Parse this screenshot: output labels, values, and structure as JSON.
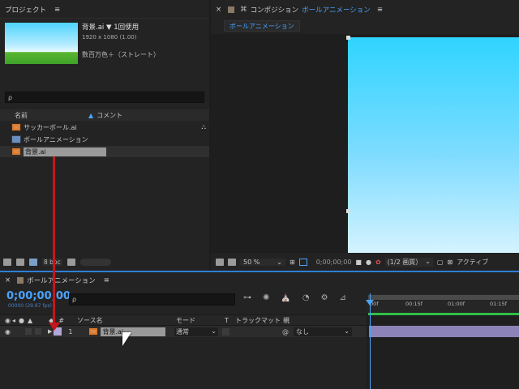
{
  "project": {
    "title": "プロジェクト",
    "menu_glyph": "≡",
    "selected_name": "背景.ai ▼",
    "used_count": "1回使用",
    "resolution": "1920 x 1080 (1.00)",
    "color_mode": "数百万色＋（ストレート）",
    "search_placeholder": "ρ",
    "col_name": "名前",
    "col_comment": "コメント",
    "items": [
      {
        "name": "サッカーボール.ai",
        "type": "ai"
      },
      {
        "name": "ボールアニメーション",
        "type": "comp"
      },
      {
        "name": "背景.ai",
        "type": "ai"
      }
    ],
    "bpc": "8 bpc"
  },
  "comp_viewer": {
    "close_glyph": "×",
    "title_prefix": "コンポジション",
    "comp_name": "ボールアニメーション",
    "menu_glyph": "≡",
    "tab": "ボールアニメーション",
    "zoom": "50 %",
    "timecode": "0;00;00;00",
    "resolution": "(1/2 画質）",
    "active_camera": "アクティブ"
  },
  "timeline": {
    "close_glyph": "×",
    "title": "ボールアニメーション",
    "menu_glyph": "≡",
    "timecode": "0;00;00;00",
    "fps": "00000 (29.97 fps)",
    "columns": {
      "hash": "#",
      "source": "ソース名",
      "mode": "モード",
      "t": "T",
      "trackmatte": "トラックマット",
      "parent": "親"
    },
    "ruler": [
      "00f",
      "00:15f",
      "01:00f",
      "01:15f"
    ],
    "layer": {
      "index": "1",
      "name": "背景.ai",
      "mode": "通常",
      "parent": "なし"
    }
  },
  "colors": {
    "accent": "#4aa3ff",
    "arrow": "#c4161c",
    "sky_top": "#2fd4ff",
    "sky_bottom": "#e8f8ff",
    "layer_bar": "#8c84b8"
  }
}
